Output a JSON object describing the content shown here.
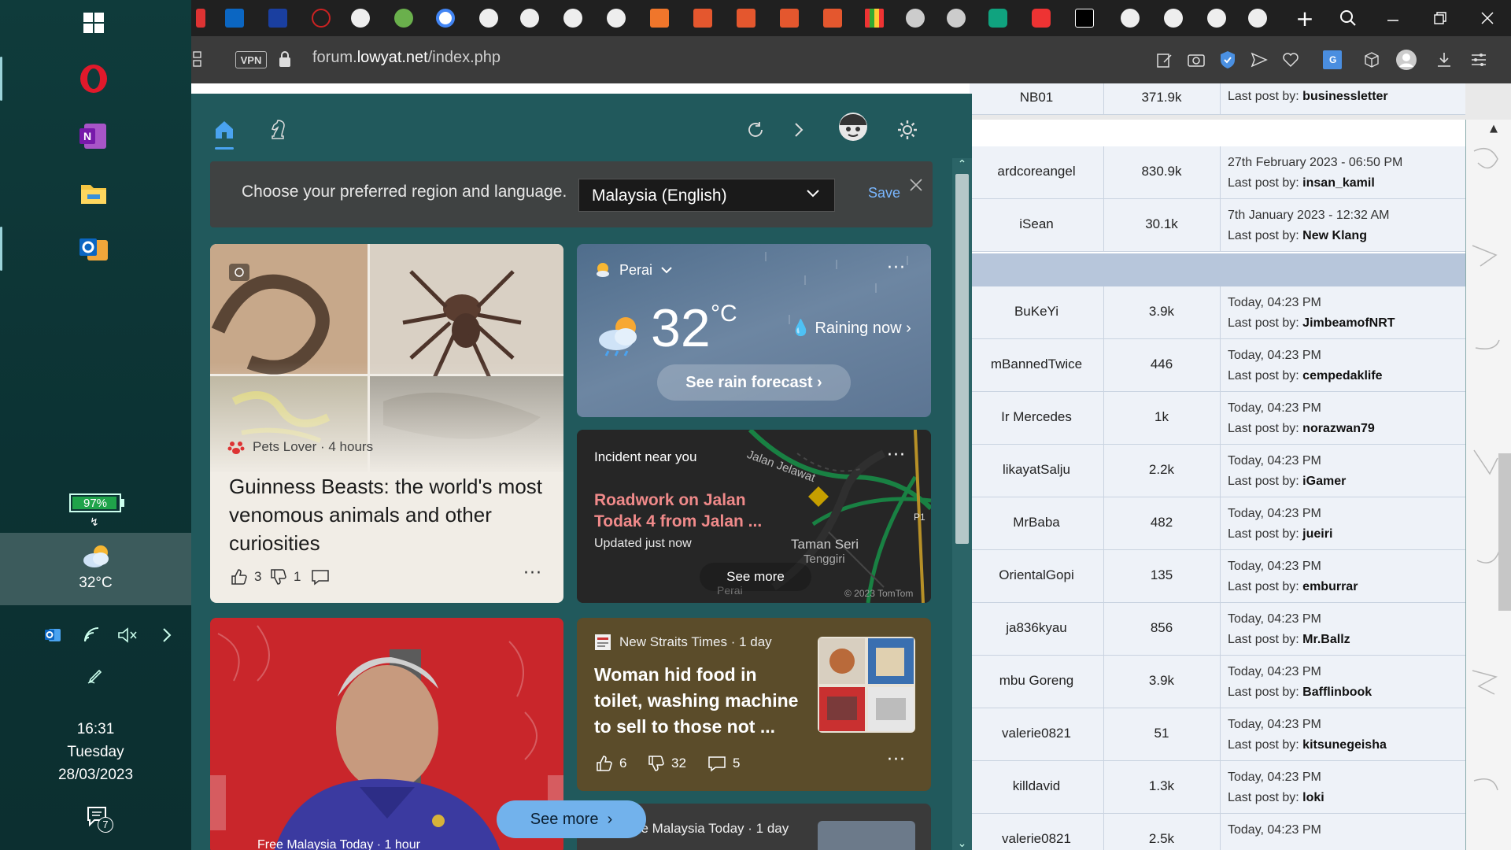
{
  "browser": {
    "vpn_label": "VPN",
    "url_host_prefix": "forum.",
    "url_host_main": "lowyat.net",
    "url_path": "/index.php"
  },
  "taskbar": {
    "battery_percent": 97,
    "battery_label": "97%",
    "weather_temp": "32°C",
    "time": "16:31",
    "day": "Tuesday",
    "date": "28/03/2023",
    "notification_count": "7",
    "colors": {
      "background": "#0c3233",
      "battery_fill": "#1fa34a"
    }
  },
  "widgets": {
    "region_prompt": "Choose your preferred region and language.",
    "region_selected": "Malaysia (English)",
    "region_save": "Save",
    "see_more": "See more",
    "cards": {
      "beasts": {
        "source": "Pets Lover · 4 hours",
        "title": "Guinness Beasts: the world's most venomous animals and other curiosities",
        "likes": "3",
        "dislikes": "1"
      },
      "weather": {
        "location": "Perai",
        "temp": "32",
        "unit": "°C",
        "condition": "Raining now",
        "button": "See rain forecast"
      },
      "incident": {
        "label": "Incident near you",
        "title": "Roadwork on Jalan Todak 4 from Jalan ...",
        "updated": "Updated just now",
        "button": "See more",
        "map_label_1": "Jalan Jelawat",
        "map_label_2": "Taman Seri",
        "map_label_3": "Tenggiri",
        "map_label_4": "Perai",
        "map_label_5": "P1",
        "map_copyright": "© 2023 TomTom"
      },
      "nst": {
        "source": "New Straits Times · 1 day",
        "title": "Woman hid food in toilet, washing machine to sell to those not ...",
        "likes": "6",
        "dislikes": "32",
        "comments": "5"
      },
      "fmt": {
        "source": "Free Malaysia Today · 1 day"
      },
      "politic": {
        "source": "Free Malaysia Today · 1 hour"
      }
    }
  },
  "forum": {
    "rows": [
      {
        "name": "NB01",
        "count": "371.9k",
        "date": "",
        "poster": "businessletter"
      },
      {
        "name": "ardcoreangel",
        "count": "830.9k",
        "date": "27th February 2023 - 06:50 PM",
        "poster": "insan_kamil"
      },
      {
        "name": "iSean",
        "count": "30.1k",
        "date": "7th January 2023 - 12:32 AM",
        "poster": "New Klang"
      },
      {
        "name": "BuKeYi",
        "count": "3.9k",
        "date": "Today, 04:23 PM",
        "poster": "JimbeamofNRT"
      },
      {
        "name": "mBannedTwice",
        "count": "446",
        "date": "Today, 04:23 PM",
        "poster": "cempedaklife"
      },
      {
        "name": "Ir Mercedes",
        "count": "1k",
        "date": "Today, 04:23 PM",
        "poster": "norazwan79"
      },
      {
        "name": "likayatSalju",
        "count": "2.2k",
        "date": "Today, 04:23 PM",
        "poster": "iGamer"
      },
      {
        "name": "MrBaba",
        "count": "482",
        "date": "Today, 04:23 PM",
        "poster": "jueiri"
      },
      {
        "name": "OrientalGopi",
        "count": "135",
        "date": "Today, 04:23 PM",
        "poster": "emburrar"
      },
      {
        "name": "ja836kyau",
        "count": "856",
        "date": "Today, 04:23 PM",
        "poster": "Mr.Ballz"
      },
      {
        "name": "mbu Goreng",
        "count": "3.9k",
        "date": "Today, 04:23 PM",
        "poster": "Bafflinbook"
      },
      {
        "name": "valerie0821",
        "count": "51",
        "date": "Today, 04:23 PM",
        "poster": "kitsunegeisha"
      },
      {
        "name": "killdavid",
        "count": "1.3k",
        "date": "Today, 04:23 PM",
        "poster": "loki"
      },
      {
        "name": "valerie0821",
        "count": "2.5k",
        "date": "Today, 04:23 PM",
        "poster": ""
      }
    ],
    "last_post_label": "Last post by:"
  }
}
